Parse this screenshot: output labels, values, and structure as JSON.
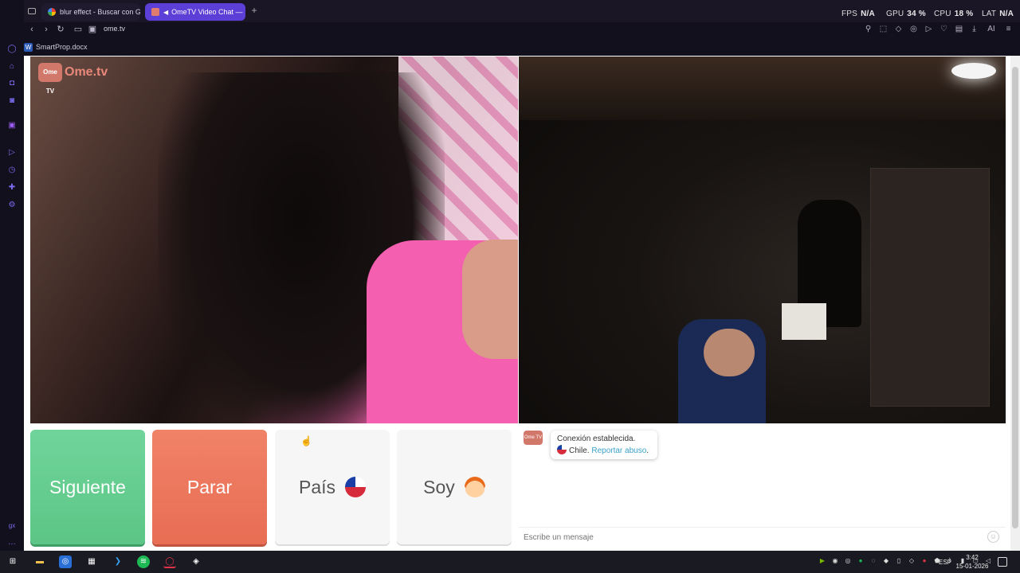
{
  "browser": {
    "tabs": [
      {
        "title": "blur effect - Buscar con Go",
        "icon": "google-icon"
      },
      {
        "title": "OmeTV Video Chat —",
        "icon": "ometv-icon",
        "active": true
      }
    ],
    "new_tab_glyph": "+",
    "url": "ome.tv",
    "bookmark": "SmartProp.docx",
    "hud": {
      "fps_label": "FPS",
      "fps_value": "N/A",
      "gpu_label": "GPU",
      "gpu_value": "34 %",
      "cpu_label": "CPU",
      "cpu_value": "18 %",
      "lat_label": "LAT",
      "lat_value": "N/A"
    },
    "ai_label": "AI"
  },
  "ometv": {
    "logo_text": "Ome.tv",
    "logo_tv_text": "Ome TV",
    "buttons": {
      "next": "Siguiente",
      "stop": "Parar",
      "country": "País",
      "gender": "Soy"
    },
    "chat": {
      "system_line1": "Conexión establecida.",
      "country": "Chile.",
      "report": "Reportar abuso",
      "report_period": ".",
      "input_placeholder": "Escribe un mensaje"
    }
  },
  "taskbar": {
    "language": "ESP",
    "time": "3:42",
    "date": "15-01-2026"
  },
  "colors": {
    "next_button": "#5cc686",
    "stop_button": "#e86d53",
    "active_tab": "#5b3fd6",
    "report_link": "#3aa0c8"
  }
}
